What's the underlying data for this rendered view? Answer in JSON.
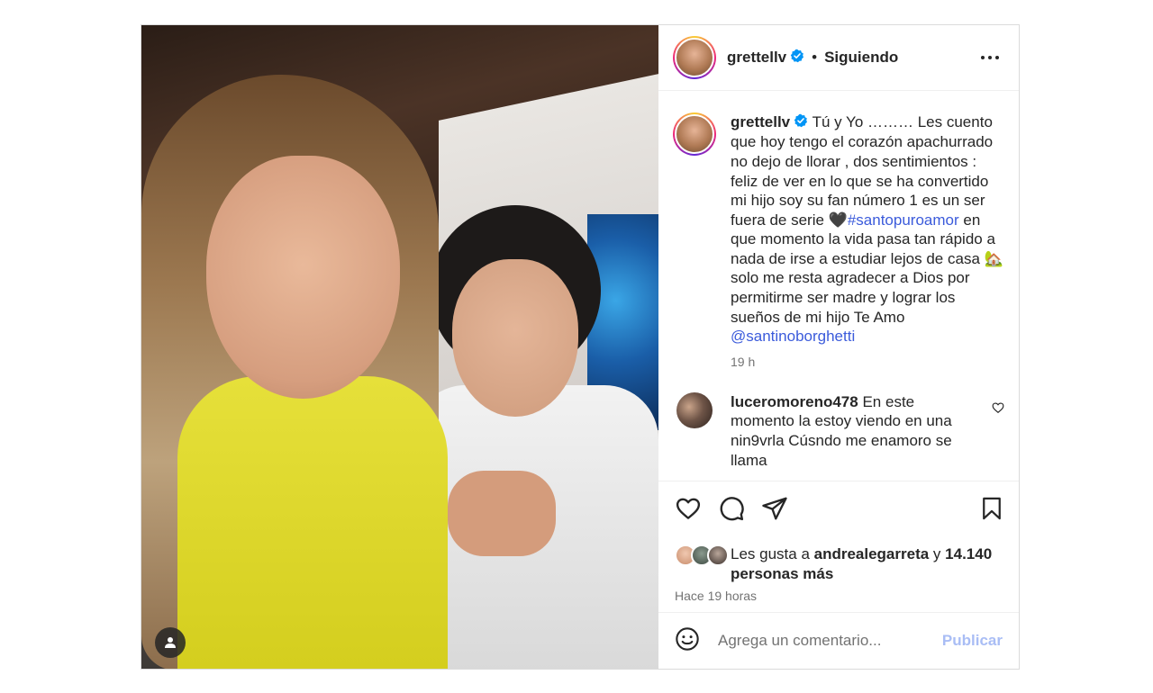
{
  "post": {
    "author": {
      "username": "grettellv",
      "verified": true,
      "follow_status": "Siguiendo",
      "separator": "•"
    },
    "caption": {
      "text_before_hashtag": "Tú y Yo ……… Les cuento que hoy tengo el corazón apachurrado no dejo de llorar , dos sentimientos : feliz de ver en lo que se ha convertido mi hijo soy su fan número 1 es un ser fuera de serie 🖤",
      "hashtag": "#santopuroamor",
      "text_after_hashtag": " en que momento la vida pasa tan rápido a nada de irse a estudiar lejos de casa 🏡 solo me resta agradecer a Dios por permitirme ser madre y lograr los sueños de mi hijo Te Amo ",
      "mention": "@santinoborghetti",
      "time": "19 h"
    },
    "comments": [
      {
        "username": "luceromoreno478",
        "text": "En este momento la estoy viendo en una nin9vrla Cúsndo me enamoro se llama"
      }
    ],
    "likes": {
      "prefix": "Les gusta a ",
      "liker": "andrealegarreta",
      "connector": " y ",
      "count_text": "14.140 personas más"
    },
    "posted_ago": "Hace 19 horas",
    "comment_box": {
      "placeholder": "Agrega un comentario...",
      "publish_label": "Publicar"
    }
  },
  "icons": {
    "tag": "user-tag-icon",
    "more": "more-options-icon",
    "like": "heart-icon",
    "comment": "comment-icon",
    "share": "share-icon",
    "save": "bookmark-icon",
    "emoji": "emoji-icon",
    "verified": "verified-badge-icon"
  },
  "colors": {
    "link": "#3b5bdb",
    "verified": "#0095f6",
    "publish_disabled": "#a9bdf5",
    "secondary_text": "#737373"
  }
}
